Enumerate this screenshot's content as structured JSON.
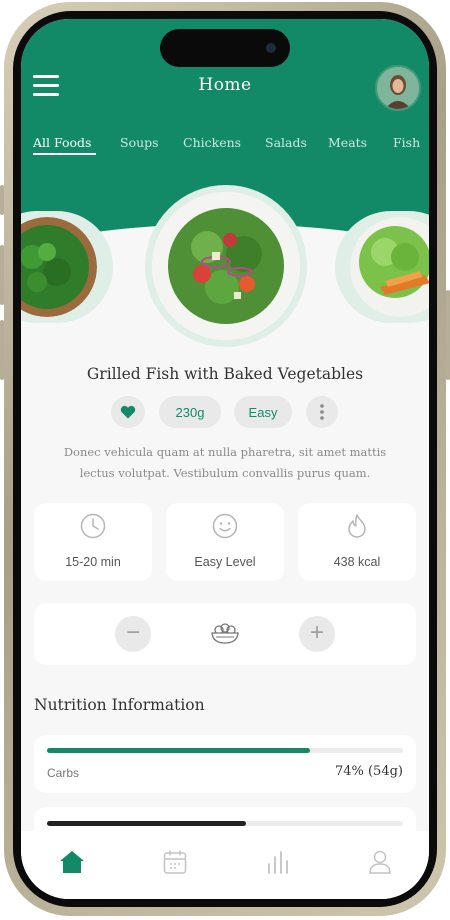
{
  "header": {
    "title": "Home"
  },
  "tabs": [
    "All Foods",
    "Soups",
    "Chickens",
    "Salads",
    "Meats",
    "Fish"
  ],
  "dish": {
    "name": "Grilled Fish with Baked Vegetables",
    "weight": "230g",
    "difficulty": "Easy",
    "description": "Donec vehicula quam at nulla pharetra, sit amet mattis lectus volutpat. Vestibulum convallis purus quam."
  },
  "stats": {
    "time": "15-20 min",
    "level": "Easy Level",
    "calories": "438 kcal"
  },
  "nutrition": {
    "title": "Nutrition Information",
    "items": [
      {
        "label": "Carbs",
        "value": "74% (54g)",
        "percent": 74
      },
      {
        "label": "",
        "value": "",
        "percent": 56
      }
    ]
  },
  "colors": {
    "brand": "#128a68",
    "background": "#f7f7f7"
  },
  "icons": {
    "menu": "hamburger-icon",
    "favorite": "heart-icon",
    "more": "more-vertical-icon",
    "time": "clock-icon",
    "level": "smile-icon",
    "calories": "flame-icon",
    "decrease": "minus-icon",
    "increase": "plus-icon",
    "bowl": "salad-bowl-icon",
    "nav": [
      "home-icon",
      "calendar-icon",
      "chart-icon",
      "user-icon"
    ]
  }
}
